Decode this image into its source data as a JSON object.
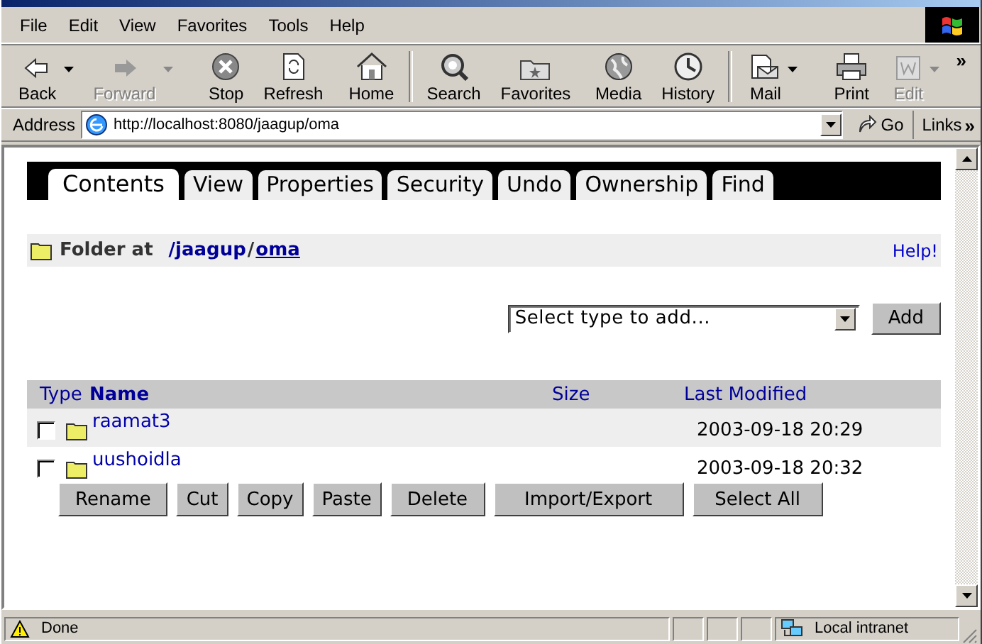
{
  "menu": [
    "File",
    "Edit",
    "View",
    "Favorites",
    "Tools",
    "Help"
  ],
  "toolbar": [
    {
      "label": "Back",
      "kind": "back",
      "disabled": false,
      "dropdown": true,
      "group_end": false
    },
    {
      "label": "Forward",
      "kind": "forward",
      "disabled": true,
      "dropdown": true,
      "group_end": false
    },
    {
      "label": "Stop",
      "kind": "stop",
      "disabled": false,
      "dropdown": false,
      "group_end": false
    },
    {
      "label": "Refresh",
      "kind": "refresh",
      "disabled": false,
      "dropdown": false,
      "group_end": false
    },
    {
      "label": "Home",
      "kind": "home",
      "disabled": false,
      "dropdown": false,
      "group_end": true
    },
    {
      "label": "Search",
      "kind": "search",
      "disabled": false,
      "dropdown": false,
      "group_end": false
    },
    {
      "label": "Favorites",
      "kind": "favorites",
      "disabled": false,
      "dropdown": false,
      "group_end": false
    },
    {
      "label": "Media",
      "kind": "media",
      "disabled": false,
      "dropdown": false,
      "group_end": false
    },
    {
      "label": "History",
      "kind": "history",
      "disabled": false,
      "dropdown": false,
      "group_end": true
    },
    {
      "label": "Mail",
      "kind": "mail",
      "disabled": false,
      "dropdown": true,
      "group_end": false
    },
    {
      "label": "Print",
      "kind": "print",
      "disabled": false,
      "dropdown": false,
      "group_end": false
    },
    {
      "label": "Edit",
      "kind": "edit",
      "disabled": true,
      "dropdown": true,
      "group_end": false
    }
  ],
  "toolbar_more": "»",
  "address": {
    "label": "Address",
    "value": "http://localhost:8080/jaagup/oma",
    "go": "Go",
    "links": "Links",
    "links_more": "»"
  },
  "tabs": [
    {
      "label": "Contents",
      "selected": true
    },
    {
      "label": "View",
      "selected": false
    },
    {
      "label": "Properties",
      "selected": false
    },
    {
      "label": "Security",
      "selected": false
    },
    {
      "label": "Undo",
      "selected": false
    },
    {
      "label": "Ownership",
      "selected": false
    },
    {
      "label": "Find",
      "selected": false
    }
  ],
  "location": {
    "label": "Folder at",
    "path": "/jaagup",
    "separator": "/",
    "current": "oma",
    "help": "Help!"
  },
  "add": {
    "value": "Select type to add...",
    "button": "Add"
  },
  "table": {
    "columns": [
      "Type",
      "Name",
      "Size",
      "Last Modified"
    ],
    "rows": [
      {
        "name": "raamat3",
        "modified": "2003-09-18 20:29",
        "checked": false
      },
      {
        "name": "uushoidla",
        "modified": "2003-09-18 20:32",
        "checked": false
      }
    ]
  },
  "actions": [
    "Rename",
    "Cut",
    "Copy",
    "Paste",
    "Delete",
    "Import/Export",
    "Select All"
  ],
  "status": {
    "text": "Done",
    "zone": "Local intranet"
  }
}
